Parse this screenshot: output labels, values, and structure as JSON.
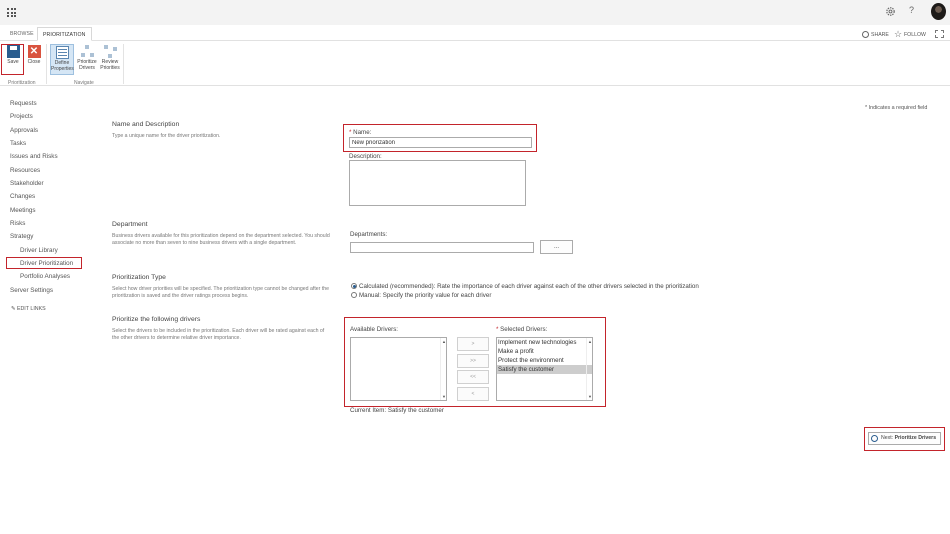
{
  "ribbon_tabs": {
    "browse": "BROWSE",
    "prioritization": "PRIORITIZATION"
  },
  "top_links": {
    "share": "SHARE",
    "follow": "FOLLOW"
  },
  "ribbon": {
    "save": "Save",
    "close": "Close",
    "define": [
      "Define",
      "Properties"
    ],
    "prioritize": [
      "Prioritize",
      "Drivers"
    ],
    "review": [
      "Review",
      "Priorities"
    ],
    "group_prioritization": "Prioritization",
    "group_navigate": "Navigate"
  },
  "icons": {
    "app_launcher": "waffle-icon",
    "settings": "gear-icon",
    "help": "help-icon",
    "share": "share-icon",
    "follow": "star-icon",
    "focus": "focus-icon",
    "edit_links": "pencil-icon"
  },
  "colors": {
    "highlight": "#c3242b",
    "accent": "#2a5d8f",
    "selected_item": "#cdcdcd"
  },
  "nav": {
    "items": [
      "Requests",
      "Projects",
      "Approvals",
      "Tasks",
      "Issues and Risks",
      "Resources",
      "Stakeholder",
      "Changes",
      "Meetings",
      "Risks",
      "Strategy"
    ],
    "sub_items": [
      "Driver Library",
      "Driver Prioritization",
      "Portfolio Analyses"
    ],
    "server_settings": "Server Settings",
    "edit_links": "EDIT LINKS"
  },
  "required_note": "* Indicates a required field",
  "sections": {
    "name": {
      "title": "Name and Description",
      "desc": "Type a unique name for the driver prioritization.",
      "name_label": "Name:",
      "name_value": "New priorization",
      "description_label": "Description:",
      "description_value": ""
    },
    "department": {
      "title": "Department",
      "desc": "Business drivers available for this prioritization depend on the department selected. You should associate no more than seven to nine business drivers with a single department.",
      "label": "Departments:",
      "value": "",
      "browse_button": "..."
    },
    "type": {
      "title": "Prioritization Type",
      "desc": "Select how driver priorities will be specified. The prioritization type cannot be changed after the prioritization is saved and the driver ratings process begins.",
      "option_calculated": "Calculated (recommended): Rate the importance of each driver against each of the other drivers selected in the prioritization",
      "option_manual": "Manual: Specify the priority value for each driver",
      "selected": "calculated"
    },
    "drivers": {
      "title": "Prioritize the following drivers",
      "desc": "Select the drivers to be included in the prioritization. Each driver will be rated against each of the other drivers to determine relative driver importance.",
      "available_label": "Available Drivers:",
      "selected_label": "Selected Drivers:",
      "available": [],
      "selected": [
        "Implement new technologies",
        "Make a profit",
        "Protect the environment",
        "Satisfy the customer"
      ],
      "selected_index": 3,
      "move_buttons": [
        ">",
        ">>",
        "<<",
        "<"
      ],
      "current_item": "Current Item: Satisfy the customer"
    }
  },
  "next_button": {
    "prefix": "Next: ",
    "label": "Prioritize Drivers"
  }
}
